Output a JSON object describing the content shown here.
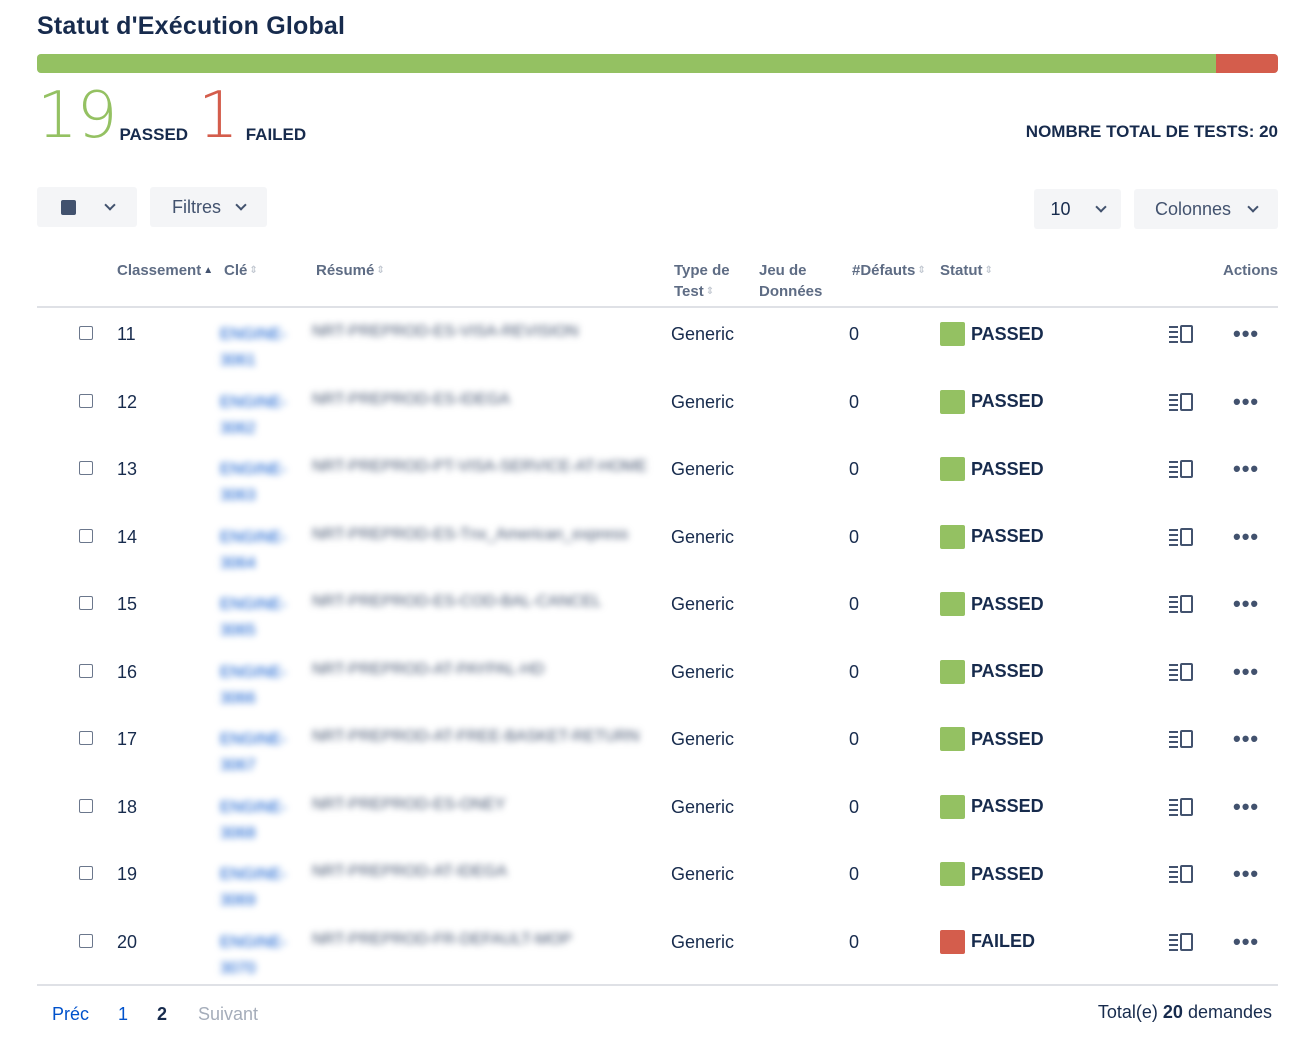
{
  "title": "Statut d'Exécution Global",
  "colors": {
    "passed": "#94c162",
    "failed": "#d45d4c",
    "link": "#0052cc"
  },
  "progress": {
    "passed_fraction": 0.95,
    "failed_fraction": 0.05
  },
  "summary": {
    "passed_count": "19",
    "passed_label": "PASSED",
    "failed_count": "1",
    "failed_label": "FAILED",
    "total_label": "NOMBRE TOTAL DE TESTS: 20"
  },
  "toolbar": {
    "select_icon": "square-icon",
    "filters_label": "Filtres",
    "page_size": "10",
    "columns_label": "Colonnes"
  },
  "table": {
    "headers": {
      "rank": "Classement",
      "key": "Clé",
      "summary": "Résumé",
      "test_type_1": "Type de",
      "test_type_2": "Test",
      "dataset_1": "Jeu de",
      "dataset_2": "Données",
      "defects": "#Défauts",
      "status": "Statut",
      "actions": "Actions"
    },
    "rows": [
      {
        "rank": "11",
        "key": "ENGINE-3061",
        "summary": "NRT-PREPROD-ES-VISA-REVISION",
        "type": "Generic",
        "defects": "0",
        "status": "PASSED",
        "status_color": "#94c162"
      },
      {
        "rank": "12",
        "key": "ENGINE-3062",
        "summary": "NRT-PREPROD-ES-IDEGA",
        "type": "Generic",
        "defects": "0",
        "status": "PASSED",
        "status_color": "#94c162"
      },
      {
        "rank": "13",
        "key": "ENGINE-3063",
        "summary": "NRT-PREPROD-PT-VISA-SERVICE-AT-HOME",
        "type": "Generic",
        "defects": "0",
        "status": "PASSED",
        "status_color": "#94c162"
      },
      {
        "rank": "14",
        "key": "ENGINE-3064",
        "summary": "NRT-PREPROD-ES-Tnx_American_express",
        "type": "Generic",
        "defects": "0",
        "status": "PASSED",
        "status_color": "#94c162"
      },
      {
        "rank": "15",
        "key": "ENGINE-3065",
        "summary": "NRT-PREPROD-ES-COD-BAL-CANCEL",
        "type": "Generic",
        "defects": "0",
        "status": "PASSED",
        "status_color": "#94c162"
      },
      {
        "rank": "16",
        "key": "ENGINE-3066",
        "summary": "NRT-PREPROD-AT-PAYPAL-HD",
        "type": "Generic",
        "defects": "0",
        "status": "PASSED",
        "status_color": "#94c162"
      },
      {
        "rank": "17",
        "key": "ENGINE-3067",
        "summary": "NRT-PREPROD-AT-FREE-BASKET-RETURN",
        "type": "Generic",
        "defects": "0",
        "status": "PASSED",
        "status_color": "#94c162"
      },
      {
        "rank": "18",
        "key": "ENGINE-3068",
        "summary": "NRT-PREPROD-ES-ONEY",
        "type": "Generic",
        "defects": "0",
        "status": "PASSED",
        "status_color": "#94c162"
      },
      {
        "rank": "19",
        "key": "ENGINE-3069",
        "summary": "NRT-PREPROD-AT-IDEGA",
        "type": "Generic",
        "defects": "0",
        "status": "PASSED",
        "status_color": "#94c162"
      },
      {
        "rank": "20",
        "key": "ENGINE-3070",
        "summary": "NRT-PREPROD-FR-DEFAULT-MOP",
        "type": "Generic",
        "defects": "0",
        "status": "FAILED",
        "status_color": "#d45d4c"
      }
    ]
  },
  "pagination": {
    "prev": "Préc",
    "page1": "1",
    "page2": "2",
    "next": "Suivant",
    "total_prefix": "Total(e) ",
    "total_count": "20",
    "total_suffix": " demandes"
  }
}
